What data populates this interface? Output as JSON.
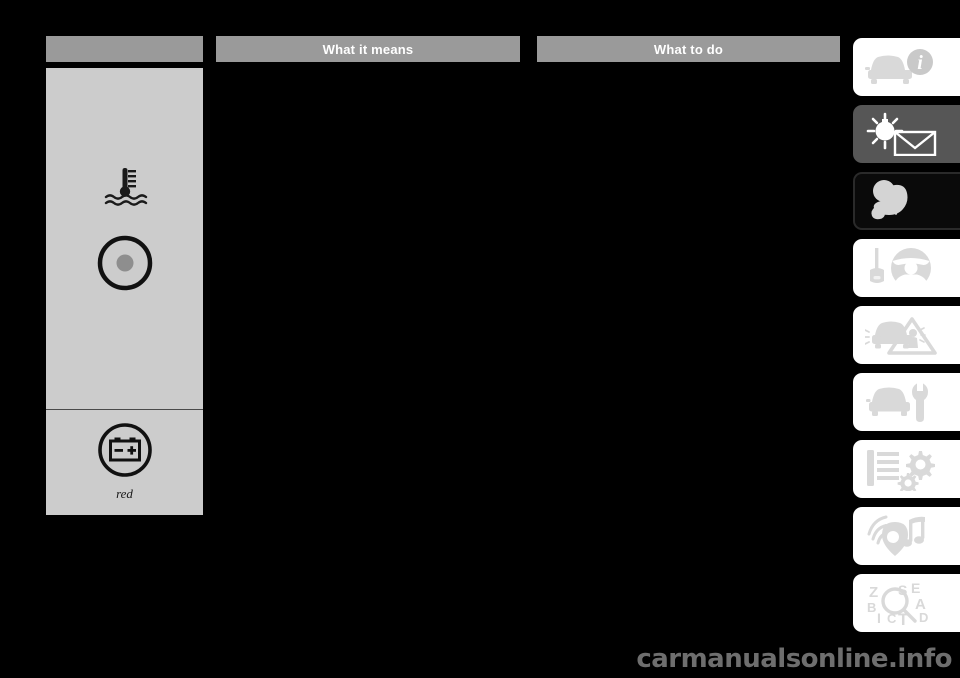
{
  "page": {
    "background_color": "#000000",
    "watermark": "carmanualsonline.info"
  },
  "table": {
    "headers": [
      {
        "id": "symbol",
        "label": ""
      },
      {
        "id": "means",
        "label": "What it means"
      },
      {
        "id": "todo",
        "label": "What to do"
      }
    ],
    "header_bg": "#9a9a9a",
    "header_text_color": "#ffffff",
    "symbol_column": {
      "background": "#cccccc",
      "rows": [
        {
          "id": "coolant-row",
          "symbols": [
            {
              "name": "coolant-temperature-icon",
              "label": ""
            },
            {
              "name": "brake-circle-icon",
              "label": ""
            }
          ]
        },
        {
          "id": "battery-row",
          "symbols": [
            {
              "name": "battery-charge-icon",
              "label": "red"
            }
          ]
        }
      ]
    },
    "cells": {
      "what_it_means": "",
      "what_to_do": ""
    }
  },
  "tab_rail": {
    "tabs": [
      {
        "id": "tab-dashboard",
        "icon": "car-info-icon",
        "state": "light"
      },
      {
        "id": "tab-warning-lights",
        "icon": "lamp-message-icon",
        "state": "dark"
      },
      {
        "id": "tab-safety",
        "icon": "child-seat-icon",
        "state": "black"
      },
      {
        "id": "tab-starting",
        "icon": "key-steering-icon",
        "state": "light"
      },
      {
        "id": "tab-emergency",
        "icon": "car-hazard-icon",
        "state": "light"
      },
      {
        "id": "tab-maintenance",
        "icon": "car-wrench-icon",
        "state": "light"
      },
      {
        "id": "tab-specifications",
        "icon": "list-gears-icon",
        "state": "light"
      },
      {
        "id": "tab-multimedia",
        "icon": "media-note-icon",
        "state": "light"
      },
      {
        "id": "tab-index",
        "icon": "alphabet-search-icon",
        "state": "light"
      }
    ]
  }
}
